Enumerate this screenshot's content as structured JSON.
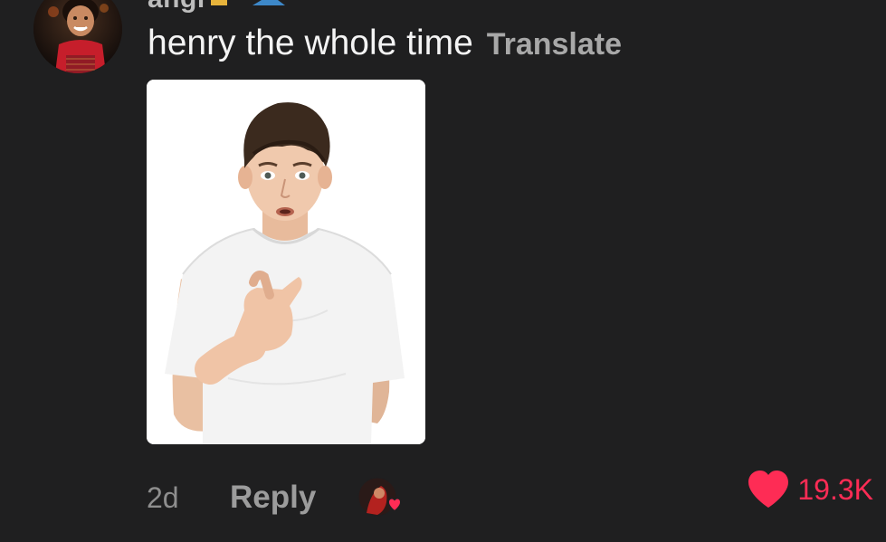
{
  "comment": {
    "username": "angi",
    "text": "henry the whole time",
    "translate_label": "Translate",
    "time": "2d",
    "reply_label": "Reply",
    "like_count": "19.3K"
  },
  "icons": {
    "like": "heart-icon",
    "creator_liked": "creator-liked-badge"
  },
  "colors": {
    "background": "#1f1f20",
    "like": "#fe2c55",
    "text": "#f4f4f4",
    "muted": "#8e8e8e"
  }
}
